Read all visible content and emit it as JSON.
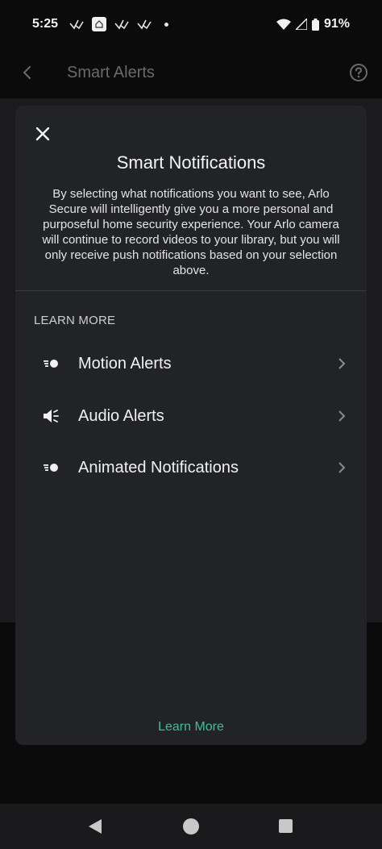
{
  "status_bar": {
    "time": "5:25",
    "battery": "91%",
    "icons": [
      "arlo-check-icon",
      "home-app-icon",
      "arlo-check-icon",
      "arlo-check-icon",
      "dot-icon",
      "wifi-icon",
      "signal-icon",
      "battery-icon"
    ]
  },
  "app_bar": {
    "title": "Smart Alerts",
    "back_icon": "chevron-left-icon",
    "help_icon": "question-circle-icon"
  },
  "sheet": {
    "title": "Smart Notifications",
    "description": "By selecting what notifications you want to see, Arlo Secure will intelligently give you a more personal and purposeful home security experience. Your Arlo camera will continue to record videos to your library, but you will only receive push notifications based on your selection above.",
    "section_label": "LEARN MORE",
    "items": [
      {
        "label": "Motion Alerts",
        "icon": "motion-icon"
      },
      {
        "label": "Audio Alerts",
        "icon": "speaker-icon"
      },
      {
        "label": "Animated Notifications",
        "icon": "motion-icon"
      }
    ],
    "learn_more": "Learn More"
  },
  "colors": {
    "background": "#0b0b0c",
    "sheet": "#222327",
    "accent": "#3fbf95"
  }
}
